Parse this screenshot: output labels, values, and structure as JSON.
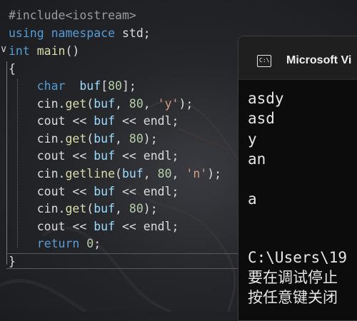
{
  "editor": {
    "lines": [
      [
        {
          "t": "#include",
          "c": "pp"
        },
        {
          "t": "<iostream>",
          "c": "pp"
        }
      ],
      [
        {
          "t": "using",
          "c": "kw"
        },
        {
          "t": " ",
          "c": "plain"
        },
        {
          "t": "namespace",
          "c": "kw"
        },
        {
          "t": " std;",
          "c": "plain"
        }
      ],
      [
        {
          "t": "int",
          "c": "ty"
        },
        {
          "t": " ",
          "c": "plain"
        },
        {
          "t": "main",
          "c": "fn"
        },
        {
          "t": "()",
          "c": "plain"
        }
      ],
      [
        {
          "t": "{",
          "c": "plain"
        }
      ],
      [
        {
          "t": "    ",
          "c": "plain"
        },
        {
          "t": "char",
          "c": "ty"
        },
        {
          "t": "  ",
          "c": "plain"
        },
        {
          "t": "buf",
          "c": "var"
        },
        {
          "t": "[",
          "c": "plain"
        },
        {
          "t": "80",
          "c": "num"
        },
        {
          "t": "];",
          "c": "plain"
        }
      ],
      [
        {
          "t": "    cin.",
          "c": "plain"
        },
        {
          "t": "get",
          "c": "fn"
        },
        {
          "t": "(",
          "c": "plain"
        },
        {
          "t": "buf",
          "c": "var"
        },
        {
          "t": ", ",
          "c": "plain"
        },
        {
          "t": "80",
          "c": "num"
        },
        {
          "t": ", ",
          "c": "plain"
        },
        {
          "t": "'y'",
          "c": "str"
        },
        {
          "t": ");",
          "c": "plain"
        }
      ],
      [
        {
          "t": "    cout << ",
          "c": "plain"
        },
        {
          "t": "buf",
          "c": "var"
        },
        {
          "t": " << endl;",
          "c": "plain"
        }
      ],
      [
        {
          "t": "    cin.",
          "c": "plain"
        },
        {
          "t": "get",
          "c": "fn"
        },
        {
          "t": "(",
          "c": "plain"
        },
        {
          "t": "buf",
          "c": "var"
        },
        {
          "t": ", ",
          "c": "plain"
        },
        {
          "t": "80",
          "c": "num"
        },
        {
          "t": ");",
          "c": "plain"
        }
      ],
      [
        {
          "t": "    cout << ",
          "c": "plain"
        },
        {
          "t": "buf",
          "c": "var"
        },
        {
          "t": " << endl;",
          "c": "plain"
        }
      ],
      [
        {
          "t": "    cin.",
          "c": "plain"
        },
        {
          "t": "getline",
          "c": "fn"
        },
        {
          "t": "(",
          "c": "plain"
        },
        {
          "t": "buf",
          "c": "var"
        },
        {
          "t": ", ",
          "c": "plain"
        },
        {
          "t": "80",
          "c": "num"
        },
        {
          "t": ", ",
          "c": "plain"
        },
        {
          "t": "'n'",
          "c": "str"
        },
        {
          "t": ");",
          "c": "plain"
        }
      ],
      [
        {
          "t": "    cout << ",
          "c": "plain"
        },
        {
          "t": "buf",
          "c": "var"
        },
        {
          "t": " << endl;",
          "c": "plain"
        }
      ],
      [
        {
          "t": "    cin.",
          "c": "plain"
        },
        {
          "t": "get",
          "c": "fn"
        },
        {
          "t": "(",
          "c": "plain"
        },
        {
          "t": "buf",
          "c": "var"
        },
        {
          "t": ", ",
          "c": "plain"
        },
        {
          "t": "80",
          "c": "num"
        },
        {
          "t": ");",
          "c": "plain"
        }
      ],
      [
        {
          "t": "    cout << ",
          "c": "plain"
        },
        {
          "t": "buf",
          "c": "var"
        },
        {
          "t": " << endl;",
          "c": "plain"
        }
      ],
      [
        {
          "t": "    ",
          "c": "plain"
        },
        {
          "t": "return",
          "c": "kw"
        },
        {
          "t": " ",
          "c": "plain"
        },
        {
          "t": "0",
          "c": "num"
        },
        {
          "t": ";",
          "c": "plain"
        }
      ],
      [
        {
          "t": "}",
          "c": "plain"
        }
      ]
    ],
    "collapse_icon": "chevron-down-icon"
  },
  "console": {
    "title": "Microsoft Vi",
    "icon": "terminal-icon",
    "icon_text": "C:\\",
    "output": [
      "asdy",
      "asd",
      "y",
      "an",
      "",
      "a",
      "",
      "C:\\Users\\19",
      "要在调试停止",
      "按任意键关闭"
    ]
  },
  "colors": {
    "keyword": "#569cd6",
    "function": "#dcdcaa",
    "variable": "#9cdcfe",
    "number": "#b5cea8",
    "string": "#d69d85",
    "preprocessor": "#9b9b9b",
    "console_bg": "#0c0c0c"
  }
}
